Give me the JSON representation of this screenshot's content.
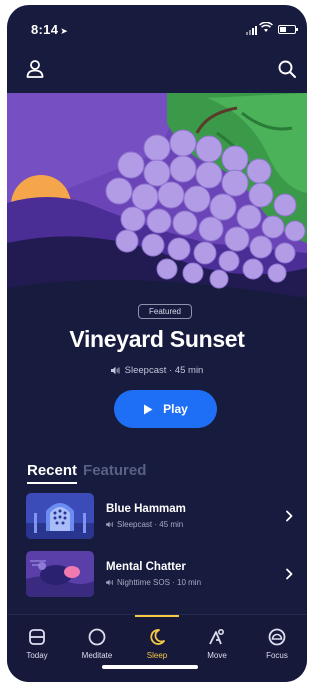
{
  "status_bar": {
    "time": "8:14"
  },
  "hero": {
    "badge": "Featured",
    "title": "Vineyard Sunset",
    "meta": "Sleepcast · 45 min",
    "play_label": "Play"
  },
  "tabs": [
    {
      "label": "Recent",
      "active": true
    },
    {
      "label": "Featured",
      "active": false
    }
  ],
  "recent_items": [
    {
      "title": "Blue Hammam",
      "meta": "Sleepcast · 45 min"
    },
    {
      "title": "Mental Chatter",
      "meta": "Nighttime SOS · 10 min"
    }
  ],
  "bottom_nav": [
    {
      "label": "Today",
      "icon": "today-icon",
      "active": false
    },
    {
      "label": "Meditate",
      "icon": "meditate-icon",
      "active": false
    },
    {
      "label": "Sleep",
      "icon": "moon-icon",
      "active": true
    },
    {
      "label": "Move",
      "icon": "move-icon",
      "active": false
    },
    {
      "label": "Focus",
      "icon": "focus-icon",
      "active": false
    }
  ],
  "colors": {
    "background": "#171b3d",
    "accent_blue": "#1f6ff6",
    "active_nav": "#f5c846",
    "hero_purple": "#6b45b8",
    "grape": "#b39ce6",
    "leaf_green": "#3a9a4a",
    "sun": "#f5a54a"
  }
}
